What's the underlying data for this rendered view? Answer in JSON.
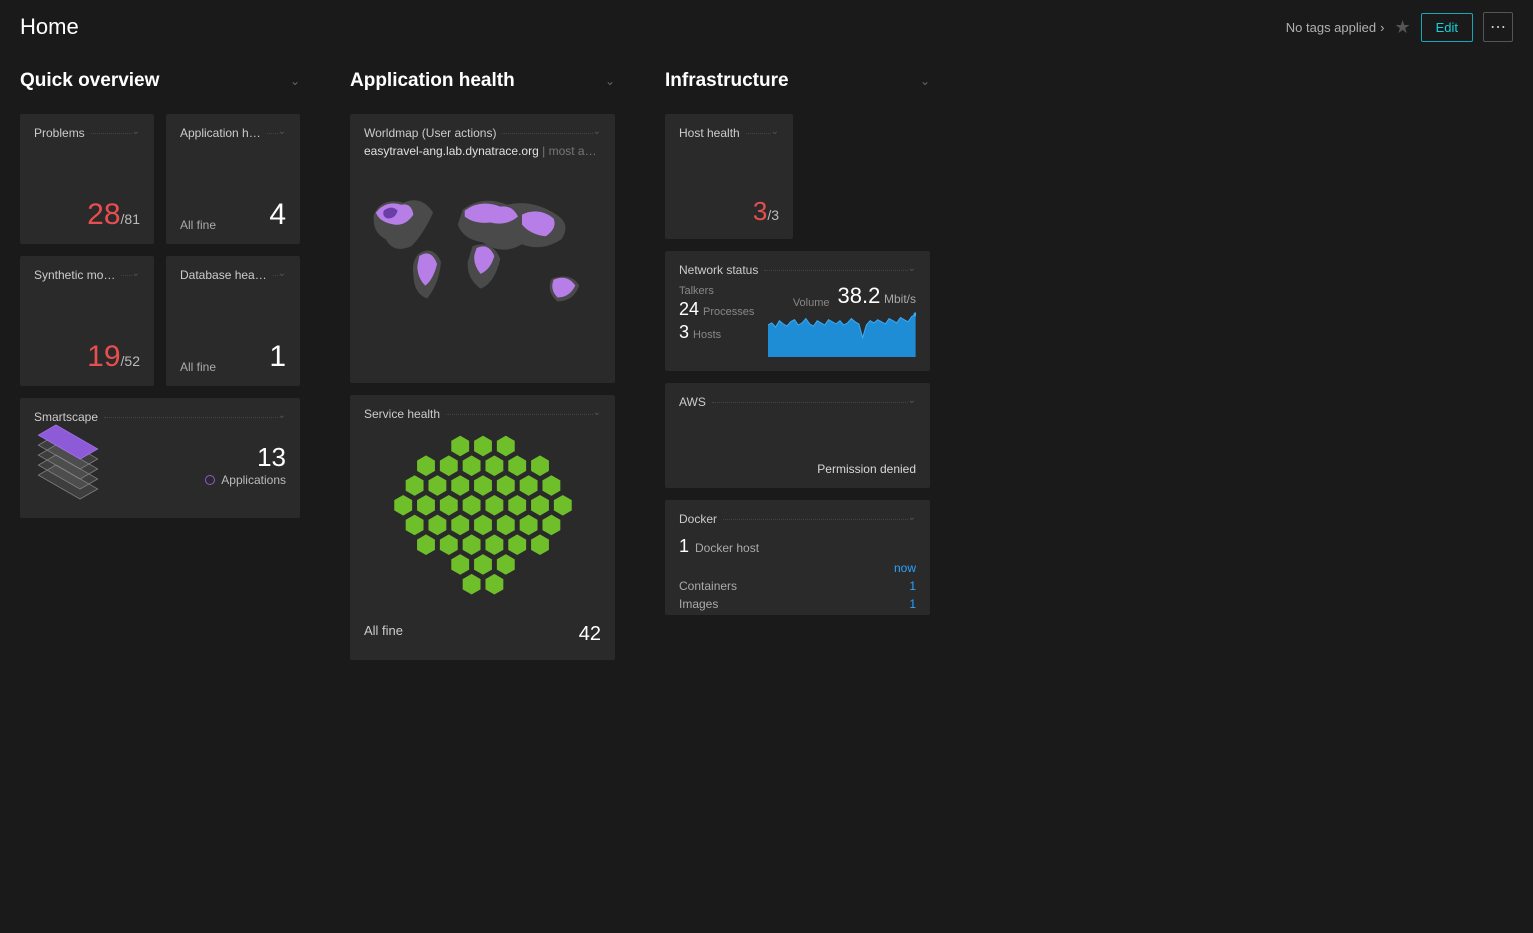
{
  "header": {
    "title": "Home",
    "tags_text": "No tags applied",
    "edit_label": "Edit"
  },
  "sections": {
    "quick_overview": {
      "title": "Quick overview"
    },
    "application_health": {
      "title": "Application health"
    },
    "infrastructure": {
      "title": "Infrastructure"
    }
  },
  "tiles": {
    "problems": {
      "title": "Problems",
      "value": "28",
      "total": "/81"
    },
    "app_health_small": {
      "title": "Application h…",
      "status": "All fine",
      "value": "4"
    },
    "synthetic": {
      "title": "Synthetic mo…",
      "value": "19",
      "total": "/52"
    },
    "db_health": {
      "title": "Database hea…",
      "status": "All fine",
      "value": "1"
    },
    "smartscape": {
      "title": "Smartscape",
      "count": "13",
      "label": "Applications"
    },
    "worldmap": {
      "title": "Worldmap (User actions)",
      "subtitle_main": "easytravel-ang.lab.dynatrace.org",
      "subtitle_muted": " | most a…"
    },
    "service_health": {
      "title": "Service health",
      "status": "All fine",
      "count": "42"
    },
    "host_health": {
      "title": "Host health",
      "value": "3",
      "total": "/3"
    },
    "network": {
      "title": "Network status",
      "talkers_label": "Talkers",
      "processes_count": "24",
      "processes_label": "Processes",
      "hosts_count": "3",
      "hosts_label": "Hosts",
      "volume_label": "Volume",
      "volume_value": "38.2",
      "volume_unit": "Mbit/s"
    },
    "aws": {
      "title": "AWS",
      "message": "Permission denied"
    },
    "docker": {
      "title": "Docker",
      "host_count": "1",
      "host_label": "Docker host",
      "now_label": "now",
      "containers_label": "Containers",
      "containers_value": "1",
      "images_label": "Images",
      "images_value": "1"
    }
  },
  "chart_data": {
    "type": "area",
    "title": "Network Volume",
    "ylabel": "Mbit/s",
    "ylim": [
      0,
      45
    ],
    "values": [
      30,
      32,
      28,
      34,
      31,
      29,
      33,
      35,
      30,
      32,
      36,
      31,
      29,
      34,
      32,
      30,
      35,
      33,
      31,
      34,
      30,
      32,
      36,
      33,
      31,
      18,
      30,
      34,
      32,
      35,
      33,
      31,
      36,
      34,
      32,
      37,
      35,
      33,
      38,
      40
    ]
  }
}
